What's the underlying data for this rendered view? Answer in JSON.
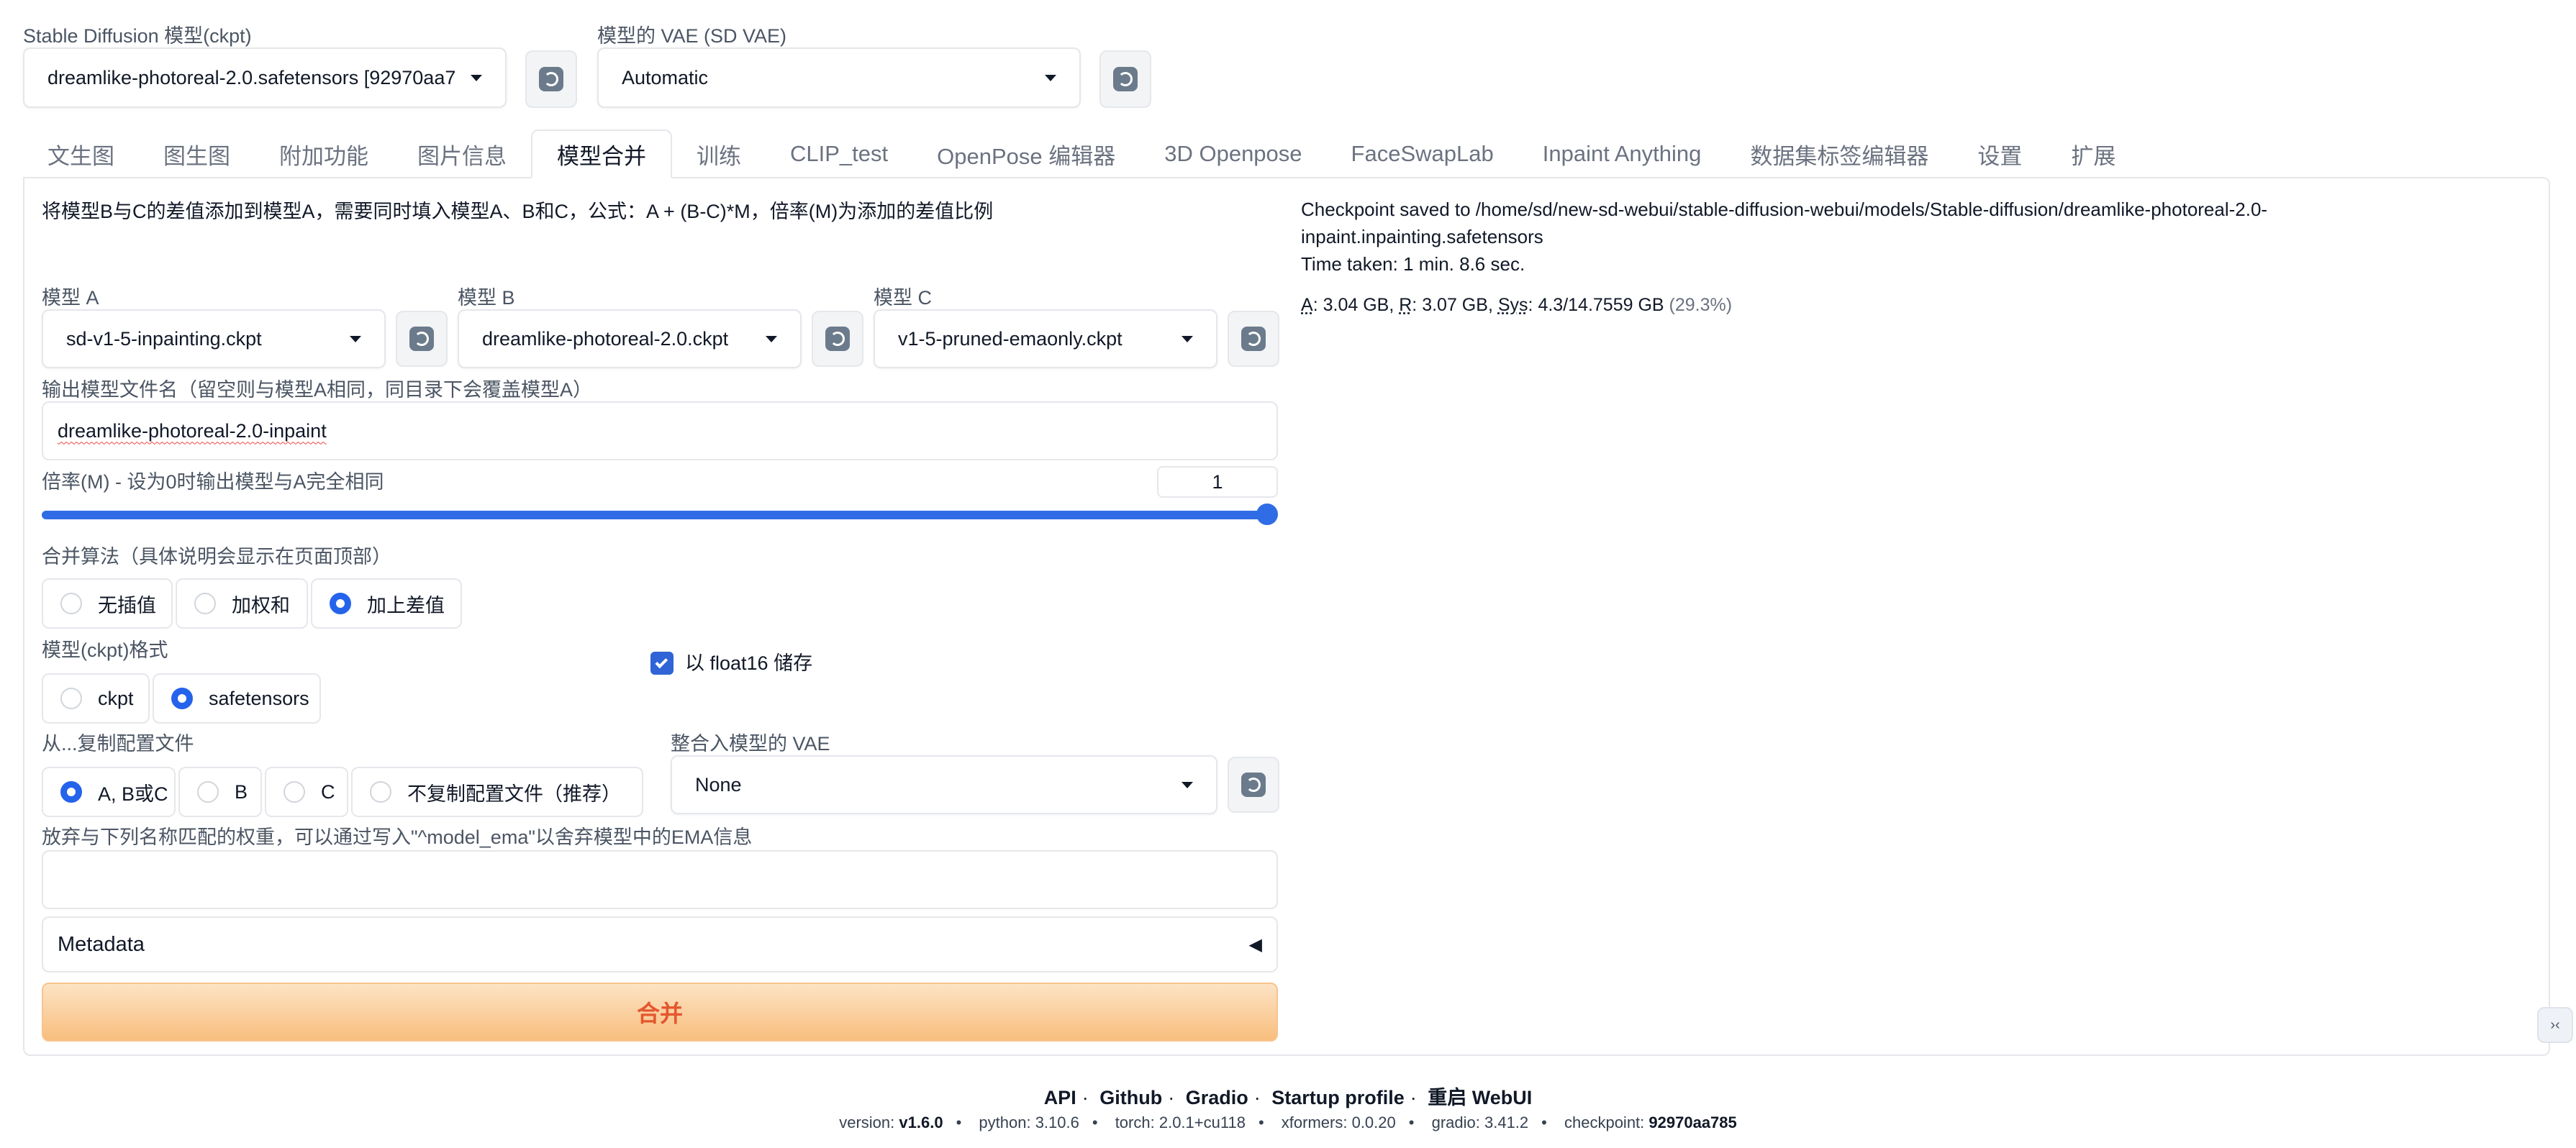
{
  "top": {
    "sd_model_label": "Stable Diffusion 模型(ckpt)",
    "sd_model_value": "dreamlike-photoreal-2.0.safetensors [92970aa7",
    "vae_label": "模型的 VAE (SD VAE)",
    "vae_value": "Automatic"
  },
  "tabs": [
    {
      "label": "文生图"
    },
    {
      "label": "图生图"
    },
    {
      "label": "附加功能"
    },
    {
      "label": "图片信息"
    },
    {
      "label": "模型合并",
      "active": true
    },
    {
      "label": "训练"
    },
    {
      "label": "CLIP_test"
    },
    {
      "label": "OpenPose 编辑器"
    },
    {
      "label": "3D Openpose"
    },
    {
      "label": "FaceSwapLab"
    },
    {
      "label": "Inpaint Anything"
    },
    {
      "label": "数据集标签编辑器"
    },
    {
      "label": "设置"
    },
    {
      "label": "扩展"
    }
  ],
  "merge": {
    "description": "将模型B与C的差值添加到模型A，需要同时填入模型A、B和C，公式：A + (B-C)*M，倍率(M)为添加的差值比例",
    "model_a_label": "模型 A",
    "model_a_value": "sd-v1-5-inpainting.ckpt",
    "model_b_label": "模型 B",
    "model_b_value": "dreamlike-photoreal-2.0.ckpt",
    "model_c_label": "模型 C",
    "model_c_value": "v1-5-pruned-emaonly.ckpt",
    "output_name_label": "输出模型文件名（留空则与模型A相同，同目录下会覆盖模型A）",
    "output_name_value": "dreamlike-photoreal-2.0-inpaint",
    "multiplier_label": "倍率(M) - 设为0时输出模型与A完全相同",
    "multiplier_value": "1",
    "multiplier_fraction": 1.0,
    "method_label": "合并算法（具体说明会显示在页面顶部）",
    "methods": [
      "无插值",
      "加权和",
      "加上差值"
    ],
    "method_selected": "加上差值",
    "format_label": "模型(ckpt)格式",
    "formats": [
      "ckpt",
      "safetensors"
    ],
    "format_selected": "safetensors",
    "float16_label": "以 float16 储存",
    "float16_checked": true,
    "copy_config_label": "从...复制配置文件",
    "copy_configs": [
      "A, B或C",
      "B",
      "C",
      "不复制配置文件（推荐）"
    ],
    "copy_config_selected": "A, B或C",
    "bake_vae_label": "整合入模型的 VAE",
    "bake_vae_value": "None",
    "discard_label": "放弃与下列名称匹配的权重，可以通过写入\"^model_ema\"以舍弃模型中的EMA信息",
    "discard_value": "",
    "metadata_label": "Metadata",
    "merge_button": "合并"
  },
  "result": {
    "line1": "Checkpoint saved to /home/sd/new-sd-webui/stable-diffusion-webui/models/Stable-diffusion/dreamlike-photoreal-2.0-",
    "line2": "inpaint.inpainting.safetensors",
    "line3": "Time taken: 1 min. 8.6 sec.",
    "stat_a_key": "A",
    "stat_a_val": "3.04 GB",
    "stat_r_key": "R",
    "stat_r_val": "3.07 GB",
    "stat_sys_key": "Sys",
    "stat_sys_val": "4.3/14.7559 GB",
    "stat_pct": "(29.3%)"
  },
  "footer": {
    "links": [
      "API",
      "Github",
      "Gradio",
      "Startup profile",
      "重启 WebUI"
    ],
    "version_label": "version:",
    "version": "v1.6.0",
    "python_label": "python:",
    "python": "3.10.6",
    "torch_label": "torch:",
    "torch": "2.0.1+cu118",
    "xformers_label": "xformers:",
    "xformers": "0.0.20",
    "gradio_label": "gradio:",
    "gradio": "3.41.2",
    "checkpoint_label": "checkpoint:",
    "checkpoint": "92970aa785"
  }
}
